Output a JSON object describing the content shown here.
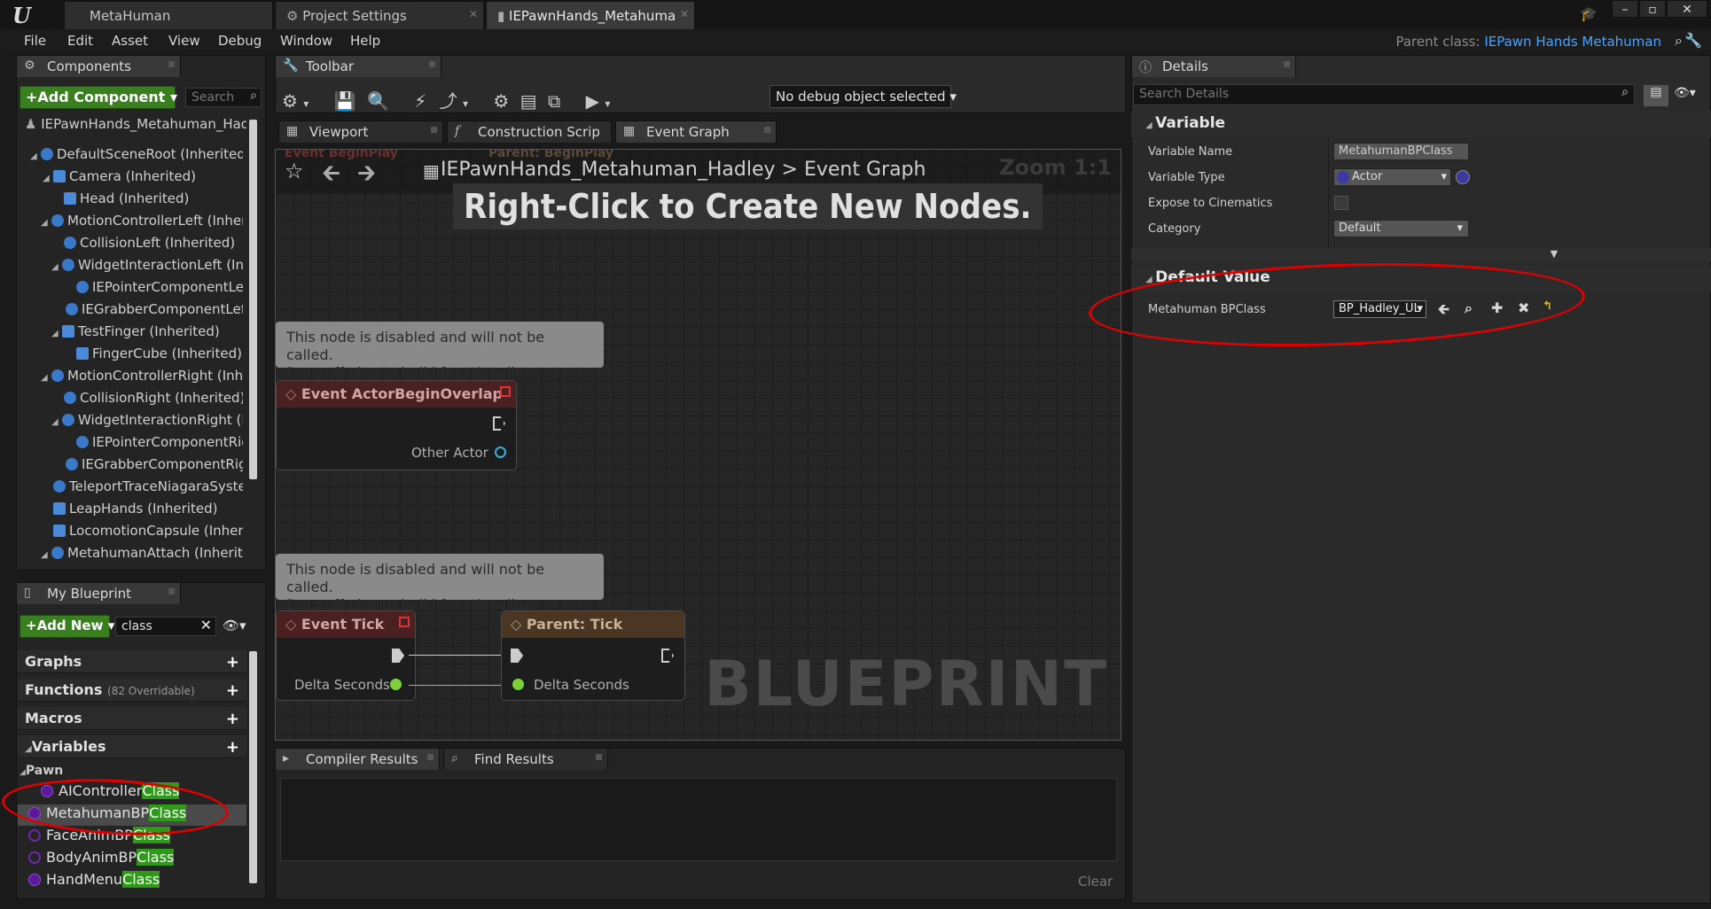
{
  "titlebar": {
    "tabs": [
      {
        "label": "MetaHuman"
      },
      {
        "label": "Project Settings"
      },
      {
        "label": "IEPawnHands_Metahuma"
      }
    ]
  },
  "menu": [
    "File",
    "Edit",
    "Asset",
    "View",
    "Debug",
    "Window",
    "Help"
  ],
  "parent_class": {
    "label": "Parent class:",
    "value": "IEPawn Hands Metahuman"
  },
  "components": {
    "tab": "Components",
    "add_button": "+Add Component",
    "search_placeholder": "Search",
    "root": "IEPawnHands_Metahuman_Hadle",
    "items": [
      "DefaultSceneRoot (Inherited)",
      "Camera (Inherited)",
      "Head (Inherited)",
      "MotionControllerLeft (Inherit",
      "CollisionLeft (Inherited)",
      "WidgetInteractionLeft (Inhe",
      "IEPointerComponentLeft",
      "IEGrabberComponentLeft (",
      "TestFinger (Inherited)",
      "FingerCube (Inherited)",
      "MotionControllerRight (Inher",
      "CollisionRight (Inherited)",
      "WidgetInteractionRight (Inl",
      "IEPointerComponentRigh",
      "IEGrabberComponentRight",
      "TeleportTraceNiagaraSystem",
      "LeapHands (Inherited)",
      "LocomotionCapsule (Inherite",
      "MetahumanAttach (Inherited"
    ]
  },
  "my_blueprint": {
    "tab": "My Blueprint",
    "add_button": "+Add New",
    "search_value": "class",
    "sections": {
      "graphs": "Graphs",
      "functions": "Functions",
      "functions_sub": "(82 Overridable)",
      "macros": "Macros",
      "variables": "Variables"
    },
    "category": "Pawn",
    "vars": [
      {
        "prefix": "AIController",
        "match": "Class"
      },
      {
        "prefix": "MetahumanBP",
        "match": "Class"
      },
      {
        "prefix": "FaceAnimBP",
        "match": "Class"
      },
      {
        "prefix": "BodyAnimBP",
        "match": "Class"
      },
      {
        "prefix": "HandMenu",
        "match": "Class"
      }
    ]
  },
  "toolbar": {
    "tab": "Toolbar",
    "debug_select": "No debug object selected"
  },
  "editor_tabs": [
    "Viewport",
    "Construction Scrip",
    "Event Graph"
  ],
  "graph": {
    "breadcrumb_root": "IEPawnHands_Metahuman_Hadley",
    "breadcrumb_sep": ">",
    "breadcrumb_leaf": "Event Graph",
    "zoom": "Zoom 1:1",
    "hint": "Right-Click to Create New Nodes.",
    "watermark": "BLUEPRINT",
    "ghost_nodes": [
      "Event BeginPlay",
      "Parent: BeginPlay"
    ],
    "disabled_note_1": "This node is disabled and will not be called.",
    "disabled_note_2": "Drag off pins to build functionality.",
    "overlap_node": "Event ActorBeginOverlap",
    "overlap_pin": "Other Actor",
    "tick_node": "Event Tick",
    "tick_pin": "Delta Seconds",
    "parent_tick_node": "Parent: Tick",
    "parent_tick_pin": "Delta Seconds"
  },
  "bottom": {
    "tabs": [
      "Compiler Results",
      "Find Results"
    ],
    "clear": "Clear"
  },
  "details": {
    "tab": "Details",
    "search_placeholder": "Search Details",
    "variable_section": "Variable",
    "rows": [
      {
        "label": "Variable Name",
        "value": "MetahumanBPClass"
      },
      {
        "label": "Variable Type",
        "value": "Actor"
      },
      {
        "label": "Expose to Cinematics",
        "value": ""
      },
      {
        "label": "Category",
        "value": "Default"
      }
    ],
    "default_section": "Default Value",
    "default_label": "Metahuman BPClass",
    "default_value": "BP_Hadley_UL"
  },
  "colors": {
    "accent_blue": "#4aa3ff",
    "green": "#3a7f1f",
    "highlight": "#2f9a1a",
    "annotation_red": "#e00000"
  }
}
